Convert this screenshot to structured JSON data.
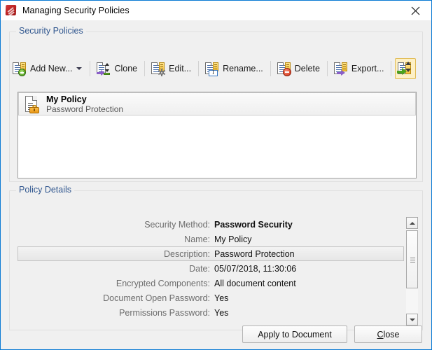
{
  "window": {
    "title": "Managing Security Policies",
    "icon": "pdf-app-icon",
    "close_icon": "close-x-icon",
    "accent_border": "#0a7ad4"
  },
  "groups": {
    "security_policies": {
      "label": "Security Policies"
    },
    "policy_details": {
      "label": "Policy Details"
    }
  },
  "toolbar": {
    "buttons": [
      {
        "id": "add-new",
        "label": "Add New...",
        "icon": "document-add-icon",
        "has_dropdown": true
      },
      {
        "id": "clone",
        "label": "Clone",
        "icon": "document-clone-icon",
        "has_dropdown": false
      },
      {
        "id": "edit",
        "label": "Edit...",
        "icon": "document-gear-icon",
        "has_dropdown": false
      },
      {
        "id": "rename",
        "label": "Rename...",
        "icon": "document-rename-icon",
        "has_dropdown": false
      },
      {
        "id": "delete",
        "label": "Delete",
        "icon": "document-delete-icon",
        "has_dropdown": false
      },
      {
        "id": "export",
        "label": "Export...",
        "icon": "document-export-icon",
        "has_dropdown": false
      },
      {
        "id": "import",
        "label": "",
        "icon": "document-import-icon",
        "has_dropdown": false
      }
    ]
  },
  "policy_list": {
    "items": [
      {
        "title": "My Policy",
        "subtitle": "Password Protection",
        "icon": "document-lock-icon",
        "selected": true
      }
    ]
  },
  "details": {
    "rows": [
      {
        "label": "Security Method:",
        "value": "Password Security",
        "bold": true,
        "highlighted": false
      },
      {
        "label": "Name:",
        "value": "My Policy",
        "bold": false,
        "highlighted": false
      },
      {
        "label": "Description:",
        "value": "Password Protection",
        "bold": false,
        "highlighted": true
      },
      {
        "label": "Date:",
        "value": "05/07/2018, 11:30:06",
        "bold": false,
        "highlighted": false
      },
      {
        "label": "Encrypted Components:",
        "value": "All document content",
        "bold": false,
        "highlighted": false
      },
      {
        "label": "Document Open Password:",
        "value": "Yes",
        "bold": false,
        "highlighted": false
      },
      {
        "label": "Permissions Password:",
        "value": "Yes",
        "bold": false,
        "highlighted": false
      }
    ]
  },
  "scrollbar": {
    "up_icon": "scroll-up-arrow-icon",
    "down_icon": "scroll-down-arrow-icon",
    "grip_icon": "scroll-thumb-grip-icon"
  },
  "footer": {
    "apply_label": "Apply to Document",
    "close_label": "Close",
    "close_accelerator": "C"
  }
}
